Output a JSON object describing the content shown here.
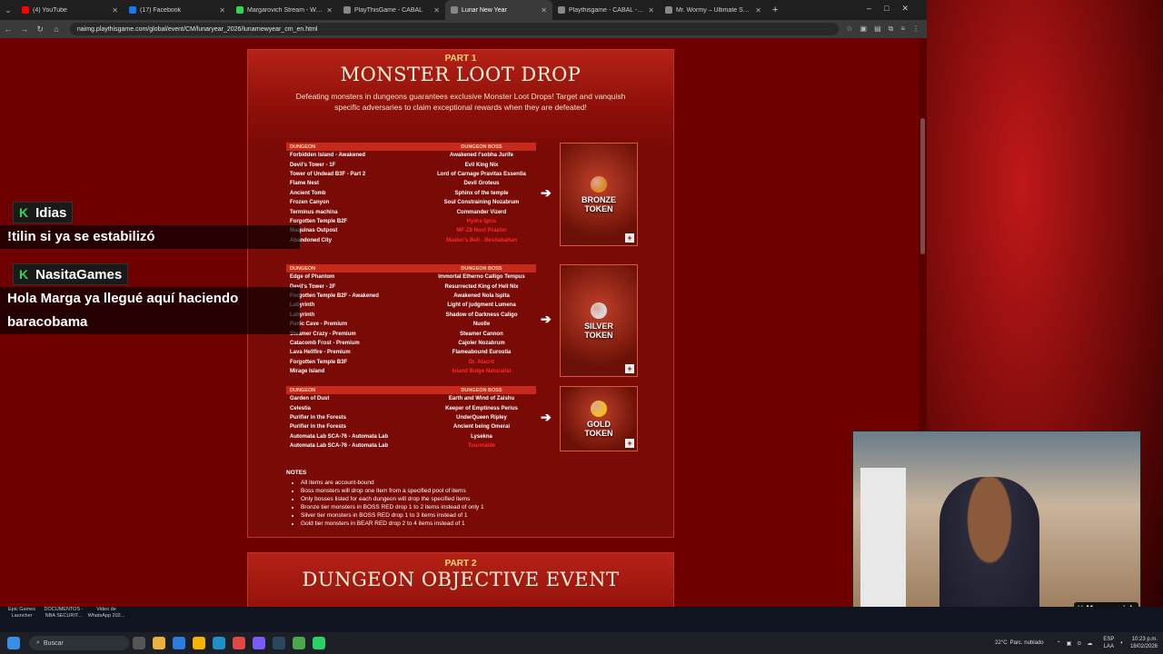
{
  "browser": {
    "tabs": [
      {
        "label": "(4) YouTube",
        "color": "#ff0000"
      },
      {
        "label": "(17) Facebook",
        "color": "#1877f2"
      },
      {
        "label": "Margarovich Stream - Watch Li",
        "color": "#39d353"
      },
      {
        "label": "PlayThisGame - CABAL",
        "color": "#888888"
      },
      {
        "label": "Lunar New Year",
        "color": "#888888",
        "active": true
      },
      {
        "label": "Playthisgame - CABAL - Notic",
        "color": "#888888"
      },
      {
        "label": "Mr. Wormy – Ultimate Source",
        "color": "#888888"
      }
    ],
    "url": "naimg.playthisgame.com/global/event/CM/lunaryear_2026/lunarnewyear_cm_en.html"
  },
  "part1": {
    "part_label": "PART 1",
    "title": "MONSTER LOOT DROP",
    "description": "Defeating monsters in dungeons guarantees exclusive Monster Loot Drops! Target and vanquish specific adversaries to claim exceptional rewards when they are defeated!",
    "header_dungeon": "DUNGEON",
    "header_boss": "DUNGEON BOSS",
    "tables": [
      {
        "token": "BRONZE TOKEN",
        "coin_color": "#d98a2a",
        "rows": [
          [
            "Forbidden Island - Awakened",
            "Awakened I'sobha Jurife"
          ],
          [
            "Devil's Tower - 1F",
            "Evil King Nix"
          ],
          [
            "Tower of Undead B3F - Part 2",
            "Lord of Carnage Pravitas Essentia"
          ],
          [
            "Flame Nest",
            "Devil Groteus"
          ],
          [
            "Ancient Tomb",
            "Sphinx of the temple"
          ],
          [
            "Frozen Canyon",
            "Soul Constraining Nozabrum"
          ],
          [
            "Terminus machina",
            "Commander Vizerd"
          ],
          [
            "Forgotten Temple B2F",
            "Hydra Ignis"
          ],
          [
            "Maquinas Outpost",
            "MF-Z8 Noct Praetor"
          ],
          [
            "Abandoned City",
            "Master's Bell - Bestiabaltan"
          ]
        ],
        "red_from": 7
      },
      {
        "token": "SILVER TOKEN",
        "coin_color": "#d8d8d8",
        "rows": [
          [
            "Edge of Phantom",
            "Immortal Etherno Calligo Tempus"
          ],
          [
            "Devil's Tower - 2F",
            "Resurrected King of Hell Nix"
          ],
          [
            "Forgotten Temple B2F - Awakened",
            "Awakened Nola Ispita"
          ],
          [
            "Labyrinth",
            "Light of judgment Lumena"
          ],
          [
            "Labyrinth",
            "Shadow of Darkness Caligo"
          ],
          [
            "Panic Cave - Premium",
            "Nuolle"
          ],
          [
            "Steamer Crazy - Premium",
            "Steamer Cannon"
          ],
          [
            "Catacomb Frost - Premium",
            "Cajoler Nozabrum"
          ],
          [
            "Lava Hellfire - Premium",
            "Flameabound Eurostia"
          ],
          [
            "Forgotten Temple B3F",
            "Dr. Alacrit"
          ],
          [
            "Mirage Island",
            "Island Bulge Naturalist"
          ]
        ],
        "red_from": 9
      },
      {
        "token": "GOLD TOKEN",
        "coin_color": "#f0c020",
        "rows": [
          [
            "Garden of Dust",
            "Earth and Wind of Zaishu"
          ],
          [
            "Celestia",
            "Keeper of Emptiness Perius"
          ],
          [
            "Purifier in the Forests",
            "UnderQueen Ripley"
          ],
          [
            "Purifier in the Forests",
            "Ancient being Omerai"
          ],
          [
            "Automata Lab SCA-76 - Automata Lab",
            "Lysekna"
          ],
          [
            "Automata Lab SCA-76 - Automata Lab",
            "Tuormalde"
          ]
        ],
        "red_from": 5
      }
    ],
    "notes_title": "NOTES",
    "notes": [
      "All items are account-bound",
      "Boss monsters will drop one item from a specified pool of items",
      "Only bosses listed for each dungeon will drop the specified items",
      "Bronze tier monsters in BOSS RED drop 1 to 2 items instead of only 1",
      "Silver tier monsters in BOSS RED drop 1 to 3 items instead of 1",
      "Gold tier monsters in BEAR RED drop 2 to 4 items instead of 1"
    ]
  },
  "part2": {
    "part_label": "PART 2",
    "title": "DUNGEON OBJECTIVE EVENT"
  },
  "chat": [
    {
      "user": "Idias",
      "message": "!tilin si ya se estabilizó"
    },
    {
      "user": "NasitaGames",
      "message": "Hola Marga ya llegué aquí haciendo baracobama"
    }
  ],
  "webcam": {
    "badge": "Margarovich"
  },
  "desktop_icons": [
    {
      "label": "Epic Games Launcher"
    },
    {
      "label": "DOCUMENTOS - NBA SECURIT..."
    },
    {
      "label": "Video de WhatsApp 202..."
    }
  ],
  "taskbar": {
    "search_placeholder": "Buscar",
    "weather": "22°C",
    "weather_desc": "Parc. nublado",
    "lang": "ESP",
    "lang2": "LAA",
    "time": "10:23 p.m.",
    "date": "18/02/2026"
  }
}
